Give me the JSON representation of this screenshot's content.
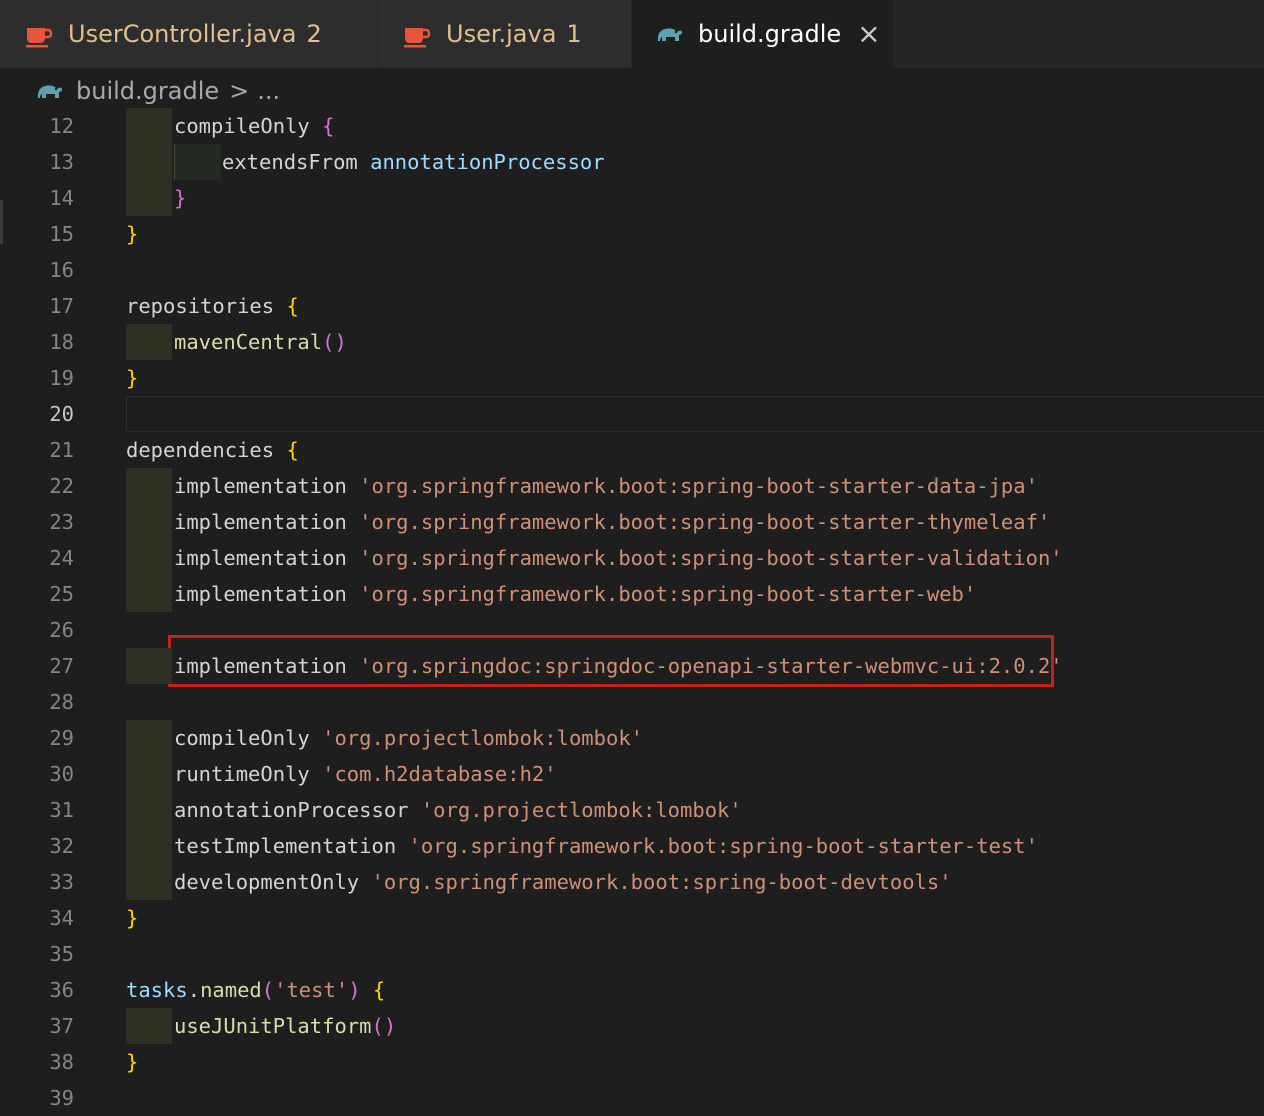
{
  "tabs": [
    {
      "label": "UserController.java",
      "badge": "2",
      "icon": "java-coffee-icon",
      "active": false
    },
    {
      "label": "User.java",
      "badge": "1",
      "icon": "java-coffee-icon",
      "active": false
    },
    {
      "label": "build.gradle",
      "badge": "",
      "icon": "gradle-elephant-icon",
      "active": true,
      "close": "×"
    }
  ],
  "breadcrumb": {
    "file": "build.gradle",
    "separator": ">",
    "more": "..."
  },
  "lines": [
    {
      "n": "12",
      "tokens": [
        [
          "compileOnly ",
          "id"
        ],
        [
          "{",
          "b2"
        ]
      ]
    },
    {
      "n": "13",
      "tokens": [
        [
          "extendsFrom ",
          "id"
        ],
        [
          "annotationProcessor",
          "var"
        ]
      ]
    },
    {
      "n": "14",
      "tokens": [
        [
          "}",
          "b2"
        ]
      ]
    },
    {
      "n": "15",
      "tokens": [
        [
          "}",
          "b1"
        ]
      ]
    },
    {
      "n": "16",
      "tokens": []
    },
    {
      "n": "17",
      "tokens": [
        [
          "repositories ",
          "id"
        ],
        [
          "{",
          "b1"
        ]
      ]
    },
    {
      "n": "18",
      "tokens": [
        [
          "mavenCentral",
          "fn"
        ],
        [
          "()",
          "b2"
        ]
      ]
    },
    {
      "n": "19",
      "tokens": [
        [
          "}",
          "b1"
        ]
      ]
    },
    {
      "n": "20",
      "tokens": []
    },
    {
      "n": "21",
      "tokens": [
        [
          "dependencies ",
          "id"
        ],
        [
          "{",
          "b1"
        ]
      ]
    },
    {
      "n": "22",
      "tokens": [
        [
          "implementation ",
          "id"
        ],
        [
          "'org.springframework.boot:spring-boot-starter-data-jpa'",
          "str"
        ]
      ]
    },
    {
      "n": "23",
      "tokens": [
        [
          "implementation ",
          "id"
        ],
        [
          "'org.springframework.boot:spring-boot-starter-thymeleaf'",
          "str"
        ]
      ]
    },
    {
      "n": "24",
      "tokens": [
        [
          "implementation ",
          "id"
        ],
        [
          "'org.springframework.boot:spring-boot-starter-validation'",
          "str"
        ]
      ]
    },
    {
      "n": "25",
      "tokens": [
        [
          "implementation ",
          "id"
        ],
        [
          "'org.springframework.boot:spring-boot-starter-web'",
          "str"
        ]
      ]
    },
    {
      "n": "26",
      "tokens": []
    },
    {
      "n": "27",
      "tokens": [
        [
          "implementation ",
          "id"
        ],
        [
          "'org.springdoc:springdoc-openapi-starter-webmvc-ui:2.0.2'",
          "str"
        ]
      ]
    },
    {
      "n": "28",
      "tokens": []
    },
    {
      "n": "29",
      "tokens": [
        [
          "compileOnly ",
          "id"
        ],
        [
          "'org.projectlombok:lombok'",
          "str"
        ]
      ]
    },
    {
      "n": "30",
      "tokens": [
        [
          "runtimeOnly ",
          "id"
        ],
        [
          "'com.h2database:h2'",
          "str"
        ]
      ]
    },
    {
      "n": "31",
      "tokens": [
        [
          "annotationProcessor ",
          "id"
        ],
        [
          "'org.projectlombok:lombok'",
          "str"
        ]
      ]
    },
    {
      "n": "32",
      "tokens": [
        [
          "testImplementation ",
          "id"
        ],
        [
          "'org.springframework.boot:spring-boot-starter-test'",
          "str"
        ]
      ]
    },
    {
      "n": "33",
      "tokens": [
        [
          "developmentOnly ",
          "id"
        ],
        [
          "'org.springframework.boot:spring-boot-devtools'",
          "str"
        ]
      ]
    },
    {
      "n": "34",
      "tokens": [
        [
          "}",
          "b1"
        ]
      ]
    },
    {
      "n": "35",
      "tokens": []
    },
    {
      "n": "36",
      "tokens": [
        [
          "tasks",
          "var"
        ],
        [
          ".",
          "id"
        ],
        [
          "named",
          "fn"
        ],
        [
          "(",
          "b2"
        ],
        [
          "'test'",
          "str"
        ],
        [
          ")",
          "b2"
        ],
        [
          " ",
          "id"
        ],
        [
          "{",
          "b1"
        ]
      ]
    },
    {
      "n": "37",
      "tokens": [
        [
          "useJUnitPlatform",
          "fn"
        ],
        [
          "()",
          "b2"
        ]
      ]
    },
    {
      "n": "38",
      "tokens": [
        [
          "}",
          "b1"
        ]
      ]
    },
    {
      "n": "39",
      "tokens": []
    }
  ],
  "current_line": "20",
  "highlighted_line": "27",
  "colors": {
    "background": "#1e1e1e",
    "string": "#ce9178",
    "function": "#dcdcaa",
    "variable": "#9cdcfe",
    "bracket_gold": "#ffd700",
    "bracket_purple": "#da70d6",
    "highlight_border": "#c4211a",
    "modified_tab_text": "#e2c08d"
  }
}
